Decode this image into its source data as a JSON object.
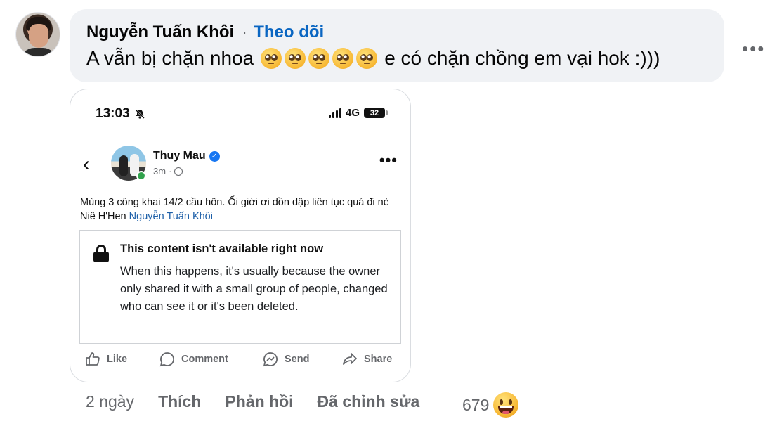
{
  "comment": {
    "author": "Nguyễn Tuấn Khôi",
    "separator": "·",
    "follow_label": "Theo dõi",
    "text_before": "A vẫn bị chặn nhoa",
    "emoji_name": "pleading-face-emoji",
    "emoji_count": 5,
    "text_after": "e có chặn chồng em vại hok :)))",
    "more_label": "•••"
  },
  "embed": {
    "status_bar": {
      "time": "13:03",
      "network": "4G",
      "battery": "32",
      "bell_icon": "bell-off-icon"
    },
    "post": {
      "back_glyph": "‹",
      "author": "Thuy Mau",
      "verified_glyph": "✓",
      "age": "3m",
      "meta_sep": "·",
      "more_glyph": "•••",
      "text": "Mùng 3 công khai 14/2 cầu hôn.  Ối giời ơi dồn dập liên tục quá đi nè Niê H'Hen ",
      "mention": "Nguyễn Tuấn Khôi"
    },
    "unavailable": {
      "title": "This content isn't available right now",
      "body": "When this happens, it's usually because the owner only shared it with a small group of people, changed who can see it or it's been deleted."
    },
    "actions": {
      "like": "Like",
      "comment": "Comment",
      "send": "Send",
      "share": "Share"
    }
  },
  "footer": {
    "time": "2 ngày",
    "like": "Thích",
    "reply": "Phản hồi",
    "edited": "Đã chỉnh sửa",
    "reaction_count": "679",
    "reaction_icon": "grinning-face-emoji"
  }
}
